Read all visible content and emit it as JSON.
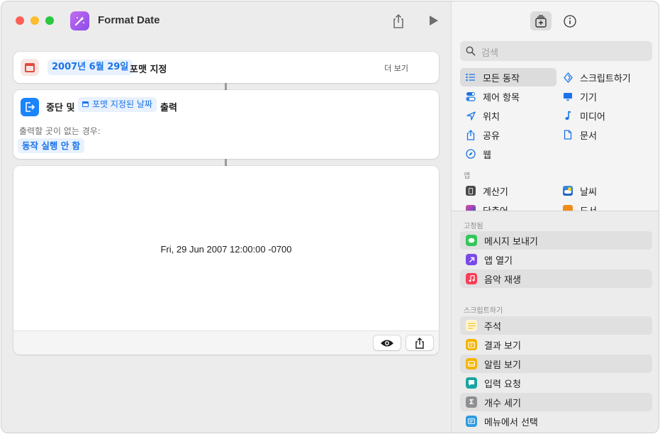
{
  "window": {
    "title": "Format Date"
  },
  "editor": {
    "action1": {
      "date_token": "2007년 6월 29일",
      "verb": "포맷 지정",
      "more_label": "더 보기"
    },
    "action2": {
      "prefix": "중단 및",
      "variable_token": "포맷 지정된 날짜",
      "suffix": "출력",
      "fallback_label": "출력할 곳이 없는 경우:",
      "fallback_value": "동작 실행 안 함"
    },
    "result": {
      "text": "Fri, 29 Jun 2007 12:00:00 -0700"
    }
  },
  "sidebar": {
    "search_placeholder": "검색",
    "categories_left": [
      {
        "label": "모든 동작",
        "icon": "list-icon",
        "selected": true
      },
      {
        "label": "제어 항목",
        "icon": "toggle-icon"
      },
      {
        "label": "위치",
        "icon": "location-icon"
      },
      {
        "label": "공유",
        "icon": "share-icon"
      },
      {
        "label": "웹",
        "icon": "compass-icon"
      }
    ],
    "categories_right": [
      {
        "label": "스크립트하기",
        "icon": "script-icon"
      },
      {
        "label": "기기",
        "icon": "display-icon"
      },
      {
        "label": "미디어",
        "icon": "music-note-icon"
      },
      {
        "label": "문서",
        "icon": "document-icon"
      }
    ],
    "apps_section_label": "앱",
    "apps": [
      {
        "label": "계산기",
        "color": "#4a4a4a"
      },
      {
        "label": "날씨",
        "color": "#2f7ed8"
      },
      {
        "label": "단축어",
        "color": "#7b3fe4"
      },
      {
        "label": "도서",
        "color": "#f08c1a"
      }
    ],
    "pinned_section_label": "고정됨",
    "pinned": [
      {
        "label": "메시지 보내기",
        "color": "#34c759",
        "icon": "message-icon"
      },
      {
        "label": "앱 열기",
        "color": "#7a4ae8",
        "icon": "arrow-up-right-icon"
      },
      {
        "label": "음악 재생",
        "color": "#fa3c55",
        "icon": "music-icon"
      }
    ],
    "scripting_section_label": "스크립트하기",
    "scripting": [
      {
        "label": "주석",
        "color": "#f5c33b",
        "icon": "lines-icon"
      },
      {
        "label": "결과 보기",
        "color": "#f5b400",
        "icon": "quote-icon"
      },
      {
        "label": "알림 보기",
        "color": "#f5b400",
        "icon": "alert-icon"
      },
      {
        "label": "입력 요청",
        "color": "#1aa6a0",
        "icon": "ask-icon"
      },
      {
        "label": "개수 세기",
        "color": "#8e8e93",
        "icon": "sigma-icon"
      },
      {
        "label": "메뉴에서 선택",
        "color": "#2f9be0",
        "icon": "menu-icon"
      }
    ]
  }
}
